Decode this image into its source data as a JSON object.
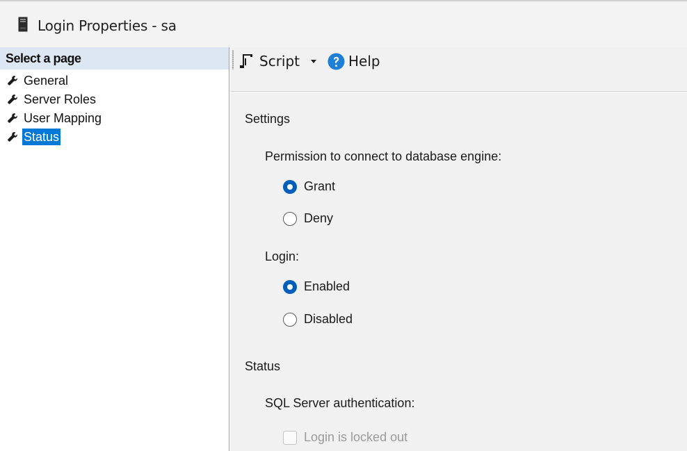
{
  "window": {
    "title": "Login Properties - sa"
  },
  "sidebar": {
    "header": "Select a page",
    "items": [
      {
        "label": "General",
        "icon": "wrench-icon"
      },
      {
        "label": "Server Roles",
        "icon": "wrench-icon"
      },
      {
        "label": "User Mapping",
        "icon": "wrench-icon"
      },
      {
        "label": "Status",
        "icon": "wrench-icon",
        "selected": true
      }
    ]
  },
  "toolbar": {
    "script_label": "Script",
    "help_label": "Help"
  },
  "settings": {
    "section_title": "Settings",
    "permission_label": "Permission to connect to database engine:",
    "permission_options": [
      {
        "label": "Grant",
        "checked": true
      },
      {
        "label": "Deny",
        "checked": false
      }
    ],
    "login_label": "Login:",
    "login_options": [
      {
        "label": "Enabled",
        "checked": true
      },
      {
        "label": "Disabled",
        "checked": false
      }
    ]
  },
  "status": {
    "section_title": "Status",
    "auth_label": "SQL Server authentication:",
    "locked_out_label": "Login is locked out",
    "locked_out_checked": false,
    "locked_out_enabled": false
  },
  "colors": {
    "accent": "#0078d7",
    "radio_selected": "#005fb8",
    "header_bg": "#dde7f3",
    "content_bg": "#f1f1f1"
  }
}
